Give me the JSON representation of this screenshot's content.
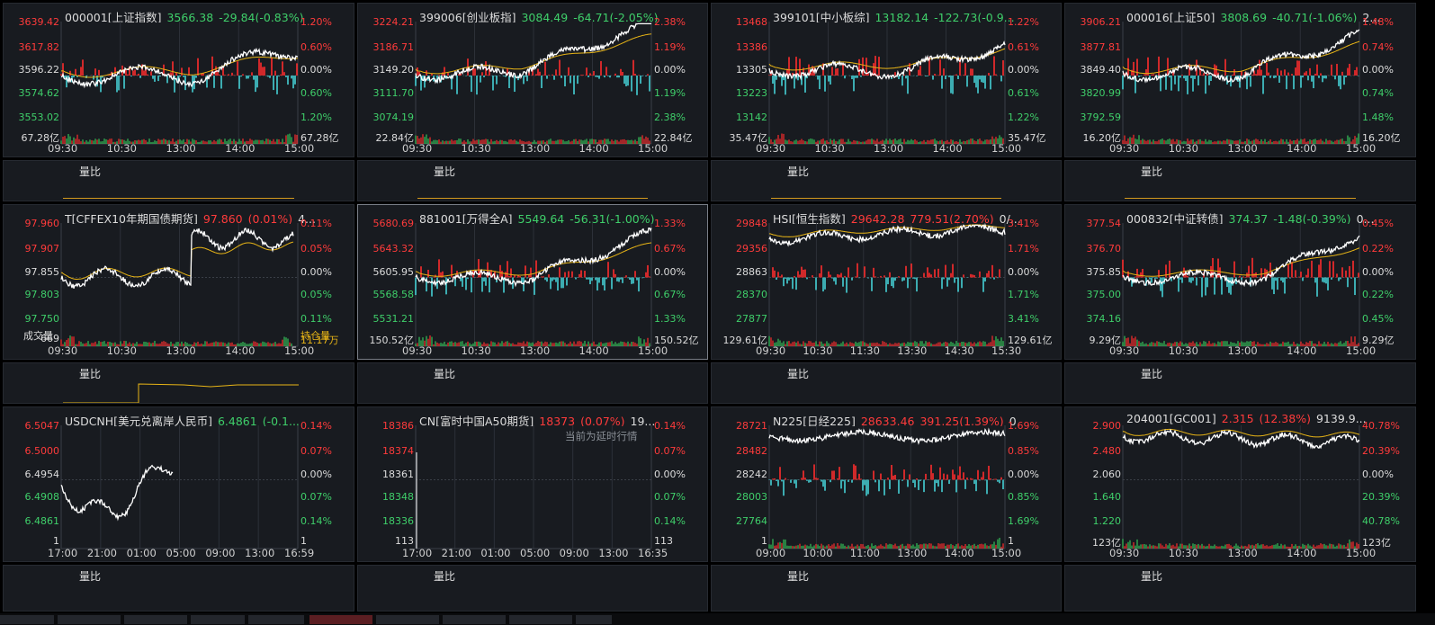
{
  "colors": {
    "up": "#ff3b3b",
    "down": "#3fcf6a",
    "price": "#ffffff",
    "avg": "#e7b416",
    "vol_bar_up": "#ff2d2d",
    "vol_bar_down": "#35c35a",
    "turquoise": "#45d1d6"
  },
  "sub_label": "量比",
  "panels": [
    {
      "id": "p1",
      "code": "000001[上证指数]",
      "price": "3566.38",
      "change": "-29.84(-0.83%)",
      "dir": "down",
      "left_labels": [
        "3639.42",
        "3617.82",
        "3596.22",
        "3574.62",
        "3553.02",
        "67.28亿"
      ],
      "right_labels": [
        "1.20%",
        "0.60%",
        "0.00%",
        "0.60%",
        "1.20%",
        "67.28亿"
      ],
      "times": [
        "09:30",
        "10:30",
        "13:00",
        "14:00",
        "15:00"
      ]
    },
    {
      "id": "p2",
      "code": "399006[创业板指]",
      "price": "3084.49",
      "change": "-64.71(-2.05%)",
      "dir": "down",
      "left_labels": [
        "3224.21",
        "3186.71",
        "3149.20",
        "3111.70",
        "3074.19",
        "22.84亿"
      ],
      "right_labels": [
        "2.38%",
        "1.19%",
        "0.00%",
        "1.19%",
        "2.38%",
        "22.84亿"
      ],
      "times": [
        "09:30",
        "10:30",
        "13:00",
        "14:00",
        "15:00"
      ]
    },
    {
      "id": "p3",
      "code": "399101[中小板综]",
      "price": "13182.14",
      "change": "-122.73(-0.9...",
      "dir": "down",
      "left_labels": [
        "13468",
        "13386",
        "13305",
        "13223",
        "13142",
        "35.47亿"
      ],
      "right_labels": [
        "1.22%",
        "0.61%",
        "0.00%",
        "0.61%",
        "1.22%",
        "35.47亿"
      ],
      "times": [
        "09:30",
        "10:30",
        "13:00",
        "14:00",
        "15:00"
      ]
    },
    {
      "id": "p4",
      "code": "000016[上证50]",
      "price": "3808.69",
      "change": "-40.71(-1.06%)",
      "extra": "2...",
      "dir": "down",
      "left_labels": [
        "3906.21",
        "3877.81",
        "3849.40",
        "3820.99",
        "3792.59",
        "16.20亿"
      ],
      "right_labels": [
        "1.48%",
        "0.74%",
        "0.00%",
        "0.74%",
        "1.48%",
        "16.20亿"
      ],
      "times": [
        "09:30",
        "10:30",
        "13:00",
        "14:00",
        "15:00"
      ]
    },
    {
      "id": "p5",
      "code": "T[CFFEX10年期国债期货]",
      "price": "97.860",
      "change": "(0.01%)",
      "extra": "4...",
      "dir": "up",
      "left_labels": [
        "97.960",
        "97.907",
        "97.855",
        "97.803",
        "97.750",
        "669"
      ],
      "right_labels": [
        "0.11%",
        "0.05%",
        "0.00%",
        "0.05%",
        "0.11%",
        "11.17万"
      ],
      "extra_labels": {
        "vol": "成交量",
        "oi": "持仓量"
      },
      "times": [
        "09:30",
        "10:30",
        "13:00",
        "14:00",
        "15:00"
      ]
    },
    {
      "id": "p6",
      "code": "881001[万得全A]",
      "price": "5549.64",
      "change": "-56.31(-1.00%)",
      "dir": "down",
      "left_labels": [
        "5680.69",
        "5643.32",
        "5605.95",
        "5568.58",
        "5531.21",
        "150.52亿"
      ],
      "right_labels": [
        "1.33%",
        "0.67%",
        "0.00%",
        "0.67%",
        "1.33%",
        "150.52亿"
      ],
      "times": [
        "09:30",
        "10:30",
        "13:00",
        "14:00",
        "15:00"
      ]
    },
    {
      "id": "p7",
      "code": "HSI[恒生指数]",
      "price": "29642.28",
      "change": "779.51(2.70%)",
      "extra": "0/...",
      "dir": "up",
      "left_labels": [
        "29848",
        "29356",
        "28863",
        "28370",
        "27877",
        "129.61亿"
      ],
      "right_labels": [
        "3.41%",
        "1.71%",
        "0.00%",
        "1.71%",
        "3.41%",
        "129.61亿"
      ],
      "times": [
        "09:30",
        "10:30",
        "11:30",
        "13:30",
        "14:30",
        "15:30"
      ]
    },
    {
      "id": "p8",
      "code": "000832[中证转债]",
      "price": "374.37",
      "change": "-1.48(-0.39%)",
      "extra": "0...",
      "dir": "down",
      "left_labels": [
        "377.54",
        "376.70",
        "375.85",
        "375.00",
        "374.16",
        "9.29亿"
      ],
      "right_labels": [
        "0.45%",
        "0.22%",
        "0.00%",
        "0.22%",
        "0.45%",
        "9.29亿"
      ],
      "times": [
        "09:30",
        "10:30",
        "13:00",
        "14:00",
        "15:00"
      ]
    },
    {
      "id": "p9",
      "code": "USDCNH[美元兑离岸人民币]",
      "price": "6.4861",
      "change": "(-0.1...",
      "dir": "down",
      "left_labels": [
        "6.5047",
        "6.5000",
        "6.4954",
        "6.4908",
        "6.4861",
        "1"
      ],
      "right_labels": [
        "0.14%",
        "0.07%",
        "0.00%",
        "0.07%",
        "0.14%",
        "1"
      ],
      "times": [
        "17:00",
        "21:00",
        "01:00",
        "05:00",
        "09:00",
        "13:00",
        "16:59"
      ]
    },
    {
      "id": "p10",
      "code": "CN[富时中国A50期货]",
      "price": "18373",
      "change": "(0.07%)",
      "extra": "19...",
      "dir": "up",
      "note": "当前为延时行情",
      "left_labels": [
        "18386",
        "18374",
        "18361",
        "18348",
        "18336",
        "113"
      ],
      "right_labels": [
        "0.14%",
        "0.07%",
        "0.00%",
        "0.07%",
        "0.14%",
        "113"
      ],
      "times": [
        "17:00",
        "21:00",
        "01:00",
        "05:00",
        "09:00",
        "13:00",
        "16:35"
      ]
    },
    {
      "id": "p11",
      "code": "N225[日经225]",
      "price": "28633.46",
      "change": "391.25(1.39%)",
      "extra": "0",
      "dir": "up",
      "left_labels": [
        "28721",
        "28482",
        "28242",
        "28003",
        "27764",
        "1"
      ],
      "right_labels": [
        "1.69%",
        "0.85%",
        "0.00%",
        "0.85%",
        "1.69%",
        "1"
      ],
      "times": [
        "09:00",
        "10:00",
        "11:00",
        "13:00",
        "14:00",
        "15:00"
      ]
    },
    {
      "id": "p12",
      "code": "204001[GC001]",
      "price": "2.315",
      "change": "(12.38%)",
      "extra": "9139.9...",
      "dir": "up",
      "left_labels": [
        "2.900",
        "2.480",
        "2.060",
        "1.640",
        "1.220",
        "123亿"
      ],
      "right_labels": [
        "40.78%",
        "20.39%",
        "0.00%",
        "20.39%",
        "40.78%",
        "123亿"
      ],
      "times": [
        "09:30",
        "10:30",
        "13:00",
        "14:00",
        "15:00"
      ]
    }
  ]
}
